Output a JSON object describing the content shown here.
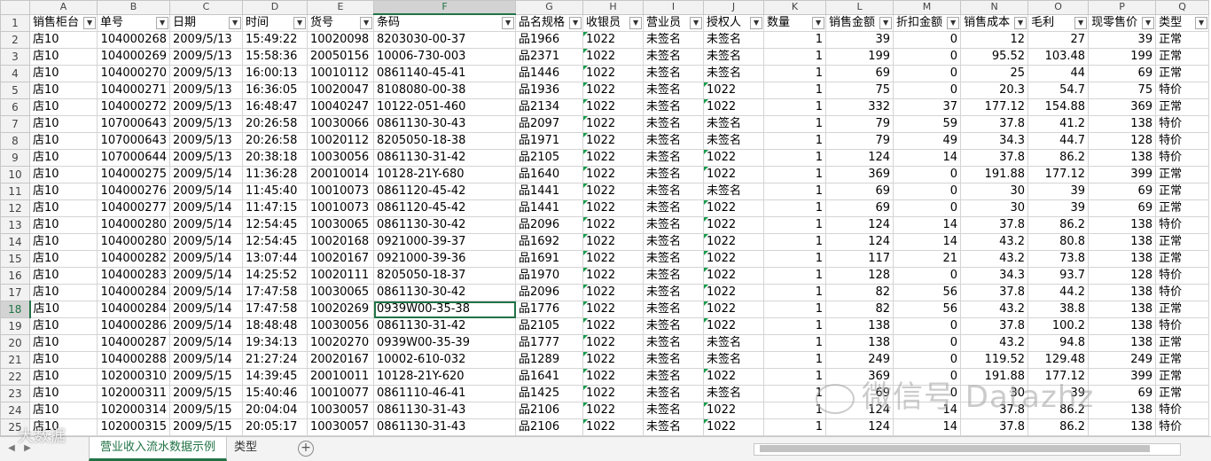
{
  "sheet": {
    "column_letters": [
      "A",
      "B",
      "C",
      "D",
      "E",
      "F",
      "G",
      "H",
      "I",
      "J",
      "K",
      "L",
      "M",
      "N",
      "O",
      "P",
      "Q"
    ],
    "header_row_number": "1",
    "headers": [
      "销售柜台",
      "单号",
      "日期",
      "时间",
      "货号",
      "条码",
      "品名规格",
      "收银员",
      "营业员",
      "授权人",
      "数量",
      "销售金额",
      "折扣金额",
      "销售成本",
      "毛利",
      "现零售价",
      "类型"
    ],
    "rows": [
      {
        "n": "2",
        "c": [
          "店10",
          "104000268",
          "2009/5/13",
          "15:49:22",
          "10020098",
          "8203030-00-37",
          "品1966",
          "1022",
          "未签名",
          "未签名",
          "1",
          "39",
          "0",
          "12",
          "27",
          "39",
          "正常"
        ]
      },
      {
        "n": "3",
        "c": [
          "店10",
          "104000269",
          "2009/5/13",
          "15:58:36",
          "20050156",
          "10006-730-003",
          "品2371",
          "1022",
          "未签名",
          "未签名",
          "1",
          "199",
          "0",
          "95.52",
          "103.48",
          "199",
          "正常"
        ]
      },
      {
        "n": "4",
        "c": [
          "店10",
          "104000270",
          "2009/5/13",
          "16:00:13",
          "10010112",
          "0861140-45-41",
          "品1446",
          "1022",
          "未签名",
          "未签名",
          "1",
          "69",
          "0",
          "25",
          "44",
          "69",
          "正常"
        ]
      },
      {
        "n": "5",
        "c": [
          "店10",
          "104000271",
          "2009/5/13",
          "16:36:05",
          "10020047",
          "8108080-00-38",
          "品1936",
          "1022",
          "未签名",
          "1022",
          "1",
          "75",
          "0",
          "20.3",
          "54.7",
          "75",
          "特价"
        ]
      },
      {
        "n": "6",
        "c": [
          "店10",
          "104000272",
          "2009/5/13",
          "16:48:47",
          "10040247",
          "10122-051-460",
          "品2134",
          "1022",
          "未签名",
          "1022",
          "1",
          "332",
          "37",
          "177.12",
          "154.88",
          "369",
          "正常"
        ]
      },
      {
        "n": "7",
        "c": [
          "店10",
          "107000643",
          "2009/5/13",
          "20:26:58",
          "10030066",
          "0861130-30-43",
          "品2097",
          "1022",
          "未签名",
          "未签名",
          "1",
          "79",
          "59",
          "37.8",
          "41.2",
          "138",
          "特价"
        ]
      },
      {
        "n": "8",
        "c": [
          "店10",
          "107000643",
          "2009/5/13",
          "20:26:58",
          "10020112",
          "8205050-18-38",
          "品1971",
          "1022",
          "未签名",
          "未签名",
          "1",
          "79",
          "49",
          "34.3",
          "44.7",
          "128",
          "特价"
        ]
      },
      {
        "n": "9",
        "c": [
          "店10",
          "107000644",
          "2009/5/13",
          "20:38:18",
          "10030056",
          "0861130-31-42",
          "品2105",
          "1022",
          "未签名",
          "1022",
          "1",
          "124",
          "14",
          "37.8",
          "86.2",
          "138",
          "特价"
        ]
      },
      {
        "n": "10",
        "c": [
          "店10",
          "104000275",
          "2009/5/14",
          "11:36:28",
          "20010014",
          "10128-21Y-680",
          "品1640",
          "1022",
          "未签名",
          "1022",
          "1",
          "369",
          "0",
          "191.88",
          "177.12",
          "399",
          "正常"
        ]
      },
      {
        "n": "11",
        "c": [
          "店10",
          "104000276",
          "2009/5/14",
          "11:45:40",
          "10010073",
          "0861120-45-42",
          "品1441",
          "1022",
          "未签名",
          "未签名",
          "1",
          "69",
          "0",
          "30",
          "39",
          "69",
          "正常"
        ]
      },
      {
        "n": "12",
        "c": [
          "店10",
          "104000277",
          "2009/5/14",
          "11:47:15",
          "10010073",
          "0861120-45-42",
          "品1441",
          "1022",
          "未签名",
          "1022",
          "1",
          "69",
          "0",
          "30",
          "39",
          "69",
          "正常"
        ]
      },
      {
        "n": "13",
        "c": [
          "店10",
          "104000280",
          "2009/5/14",
          "12:54:45",
          "10030065",
          "0861130-30-42",
          "品2096",
          "1022",
          "未签名",
          "1022",
          "1",
          "124",
          "14",
          "37.8",
          "86.2",
          "138",
          "特价"
        ]
      },
      {
        "n": "14",
        "c": [
          "店10",
          "104000280",
          "2009/5/14",
          "12:54:45",
          "10020168",
          "0921000-39-37",
          "品1692",
          "1022",
          "未签名",
          "1022",
          "1",
          "124",
          "14",
          "43.2",
          "80.8",
          "138",
          "正常"
        ]
      },
      {
        "n": "15",
        "c": [
          "店10",
          "104000282",
          "2009/5/14",
          "13:07:44",
          "10020167",
          "0921000-39-36",
          "品1691",
          "1022",
          "未签名",
          "1022",
          "1",
          "117",
          "21",
          "43.2",
          "73.8",
          "138",
          "正常"
        ]
      },
      {
        "n": "16",
        "c": [
          "店10",
          "104000283",
          "2009/5/14",
          "14:25:52",
          "10020111",
          "8205050-18-37",
          "品1970",
          "1022",
          "未签名",
          "1022",
          "1",
          "128",
          "0",
          "34.3",
          "93.7",
          "128",
          "特价"
        ]
      },
      {
        "n": "17",
        "c": [
          "店10",
          "104000284",
          "2009/5/14",
          "17:47:58",
          "10030065",
          "0861130-30-42",
          "品2096",
          "1022",
          "未签名",
          "1022",
          "1",
          "82",
          "56",
          "37.8",
          "44.2",
          "138",
          "特价"
        ]
      },
      {
        "n": "18",
        "c": [
          "店10",
          "104000284",
          "2009/5/14",
          "17:47:58",
          "10020269",
          "0939W00-35-38",
          "品1776",
          "1022",
          "未签名",
          "1022",
          "1",
          "82",
          "56",
          "43.2",
          "38.8",
          "138",
          "正常"
        ]
      },
      {
        "n": "19",
        "c": [
          "店10",
          "104000286",
          "2009/5/14",
          "18:48:48",
          "10030056",
          "0861130-31-42",
          "品2105",
          "1022",
          "未签名",
          "1022",
          "1",
          "138",
          "0",
          "37.8",
          "100.2",
          "138",
          "特价"
        ]
      },
      {
        "n": "20",
        "c": [
          "店10",
          "104000287",
          "2009/5/14",
          "19:34:13",
          "10020270",
          "0939W00-35-39",
          "品1777",
          "1022",
          "未签名",
          "未签名",
          "1",
          "138",
          "0",
          "43.2",
          "94.8",
          "138",
          "正常"
        ]
      },
      {
        "n": "21",
        "c": [
          "店10",
          "104000288",
          "2009/5/14",
          "21:27:24",
          "20020167",
          "10002-610-032",
          "品1289",
          "1022",
          "未签名",
          "未签名",
          "1",
          "249",
          "0",
          "119.52",
          "129.48",
          "249",
          "正常"
        ]
      },
      {
        "n": "22",
        "c": [
          "店10",
          "102000310",
          "2009/5/15",
          "14:39:45",
          "20010011",
          "10128-21Y-620",
          "品1641",
          "1022",
          "未签名",
          "1022",
          "1",
          "369",
          "0",
          "191.88",
          "177.12",
          "399",
          "正常"
        ]
      },
      {
        "n": "23",
        "c": [
          "店10",
          "102000311",
          "2009/5/15",
          "15:40:46",
          "10010077",
          "0861110-46-41",
          "品1425",
          "1022",
          "未签名",
          "未签名",
          "1",
          "69",
          "0",
          "30",
          "39",
          "69",
          "正常"
        ]
      },
      {
        "n": "24",
        "c": [
          "店10",
          "102000314",
          "2009/5/15",
          "20:04:04",
          "10030057",
          "0861130-31-43",
          "品2106",
          "1022",
          "未签名",
          "1022",
          "1",
          "124",
          "14",
          "37.8",
          "86.2",
          "138",
          "特价"
        ]
      },
      {
        "n": "25",
        "c": [
          "店10",
          "102000315",
          "2009/5/15",
          "20:05:17",
          "10030057",
          "0861130-31-43",
          "品2106",
          "1022",
          "未签名",
          "1022",
          "1",
          "124",
          "14",
          "37.8",
          "86.2",
          "138",
          "特价"
        ]
      }
    ]
  },
  "tabs": [
    "营业收入流水数据示例",
    "类型"
  ],
  "watermarks": {
    "left": "大数据",
    "right": "微信号 Datazhz"
  },
  "colors": {
    "accent": "#217346",
    "comment_triangle": "#169c4c"
  }
}
